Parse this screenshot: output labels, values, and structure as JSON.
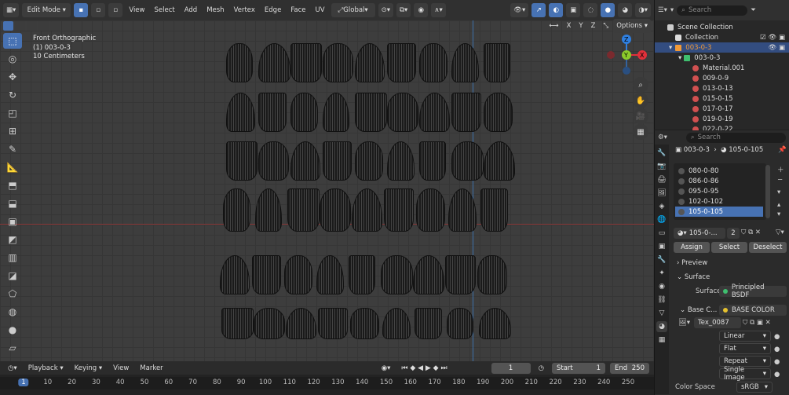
{
  "header": {
    "mode": "Edit Mode",
    "menus": [
      "View",
      "Select",
      "Add",
      "Mesh",
      "Vertex",
      "Edge",
      "Face",
      "UV"
    ],
    "transform": "Global",
    "axes": [
      "X",
      "Y",
      "Z"
    ],
    "options": "Options"
  },
  "viewport": {
    "view_name": "Front Orthographic",
    "object": "(1) 003-0-3",
    "scale": "10 Centimeters"
  },
  "gizmo": {
    "x": "X",
    "y": "Y",
    "z": "Z"
  },
  "timeline": {
    "menus": [
      "Playback",
      "Keying",
      "View",
      "Marker"
    ],
    "current": "1",
    "start_label": "Start",
    "start": "1",
    "end_label": "End",
    "end": "250",
    "ticks": [
      "1",
      "10",
      "20",
      "30",
      "40",
      "50",
      "60",
      "70",
      "80",
      "90",
      "100",
      "110",
      "120",
      "130",
      "140",
      "150",
      "160",
      "170",
      "180",
      "190",
      "200",
      "210",
      "220",
      "230",
      "240",
      "250"
    ]
  },
  "outliner": {
    "search_placeholder": "Search",
    "scene": "Scene Collection",
    "collection": "Collection",
    "object": "003-0-3",
    "mesh": "003-0-3",
    "materials": [
      "Material.001",
      "009-0-9",
      "013-0-13",
      "015-0-15",
      "017-0-17",
      "019-0-19",
      "022-0-22"
    ]
  },
  "properties": {
    "search_placeholder": "Search",
    "breadcrumb_object": "003-0-3",
    "breadcrumb_material": "105-0-105",
    "slots": [
      "080-0-80",
      "086-0-86",
      "095-0-95",
      "102-0-102",
      "105-0-105"
    ],
    "material_name": "105-0-...",
    "users": "2",
    "assign": "Assign",
    "select": "Select",
    "deselect": "Deselect",
    "preview": "Preview",
    "surface_panel": "Surface",
    "surface_label": "Surface",
    "surface_value": "Principled BSDF",
    "base_label": "Base C...",
    "base_value": "BASE COLOR",
    "texture": "Tex_0087",
    "interp": "Linear",
    "proj": "Flat",
    "ext": "Repeat",
    "source": "Single Image",
    "colorspace_label": "Color Space",
    "colorspace": "sRGB"
  },
  "colors": {
    "accent": "#4772b3",
    "x_axis": "#e0303a",
    "y_axis": "#8bcb2a",
    "z_axis": "#2f7fe0"
  }
}
